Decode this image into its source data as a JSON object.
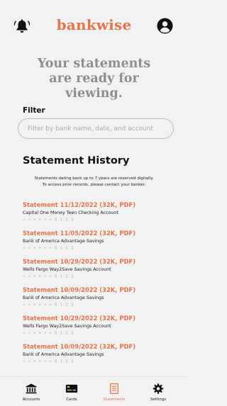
{
  "header": {
    "brand": "bankwise",
    "bell_icon": "bell-icon",
    "profile_icon": "user-circle-icon"
  },
  "hero": {
    "line1": "Your statements",
    "line2": "are ready for",
    "line3": "viewing."
  },
  "filter": {
    "label": "Filter",
    "placeholder": "Filter by bank name, date, and account",
    "value": ""
  },
  "history": {
    "title": "Statement History",
    "note_line1": "Statements dating back up to 7 years are reserved digitally.",
    "note_line2": "To access prior records, please contact your banker.",
    "statements": [
      {
        "title": "Statement 11/12/2022 (32K, PDF)",
        "account": "Capital One Money Teen Checking Account",
        "mask": "• • • • • • 0 1 2 3"
      },
      {
        "title": "Statement 11/05/2022 (32K, PDF)",
        "account": "Bank of America Advantage Savings",
        "mask": "• • • • • • 0 1 2 3"
      },
      {
        "title": "Statement 10/29/2022 (32K, PDF)",
        "account": "Wells Fargo Way2Save Savings Account",
        "mask": "• • • • • • 0 1 2 3"
      },
      {
        "title": "Statement 10/09/2022 (32K, PDF)",
        "account": "Bank of America Advantage Savings",
        "mask": "• • • • • • 0 1 2 3"
      },
      {
        "title": "Statement 10/29/2022 (32K, PDF)",
        "account": "Wells Fargo Way2Save Savings Account",
        "mask": "• • • • • • 0 1 2 3"
      },
      {
        "title": "Statement 10/09/2022 (32K, PDF)",
        "account": "Bank of America Advantage Savings",
        "mask": "• • • • • • 0 1 2 3"
      }
    ]
  },
  "nav": {
    "items": [
      {
        "label": "Accounts",
        "icon": "bank-icon",
        "active": false
      },
      {
        "label": "Cards",
        "icon": "credit-card-icon",
        "active": false
      },
      {
        "label": "Statements",
        "icon": "document-icon",
        "active": true
      },
      {
        "label": "Settings",
        "icon": "gear-icon",
        "active": false
      }
    ]
  },
  "colors": {
    "accent": "#e8734a",
    "background": "#f2f2f2",
    "hero_text": "#8e8e8e",
    "muted": "#b5b5b5"
  }
}
